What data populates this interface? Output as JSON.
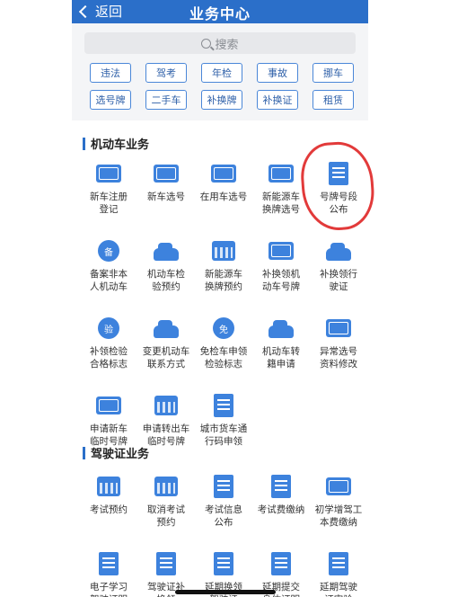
{
  "nav": {
    "back_label": "返回",
    "title": "业务中心"
  },
  "search": {
    "placeholder": "搜索"
  },
  "tags": [
    "违法",
    "驾考",
    "年检",
    "事故",
    "挪车",
    "选号牌",
    "二手车",
    "补换牌",
    "补换证",
    "租赁"
  ],
  "sections": [
    {
      "title": "机动车业务",
      "items": [
        {
          "label": "新车注册\n登记",
          "icon": "new-plate-check-icon"
        },
        {
          "label": "新车选号",
          "icon": "new-plate-icon"
        },
        {
          "label": "在用车选号",
          "icon": "no-plate-icon"
        },
        {
          "label": "新能源车\n换牌选号",
          "icon": "ev-plate-icon"
        },
        {
          "label": "号牌号段\n公布",
          "icon": "plate-announce-icon"
        },
        {
          "label": "备案非本\n人机动车",
          "icon": "record-shield-icon"
        },
        {
          "label": "机动车检\n验预约",
          "icon": "car-inspection-icon"
        },
        {
          "label": "新能源车\n换牌预约",
          "icon": "ev-calendar-icon"
        },
        {
          "label": "补换领机\n动车号牌",
          "icon": "plate-exchange-icon"
        },
        {
          "label": "补换领行\n驶证",
          "icon": "license-exchange-icon"
        },
        {
          "label": "补领检验\n合格标志",
          "icon": "inspect-badge-icon"
        },
        {
          "label": "变更机动车\n联系方式",
          "icon": "car-phone-icon"
        },
        {
          "label": "免检车申领\n检验标志",
          "icon": "exempt-badge-icon"
        },
        {
          "label": "机动车转\n籍申请",
          "icon": "car-transfer-icon"
        },
        {
          "label": "异常选号\n资料修改",
          "icon": "edit-plate-icon"
        },
        {
          "label": "申请新车\n临时号牌",
          "icon": "temp-plate-icon"
        },
        {
          "label": "申请转出车\n临时号牌",
          "icon": "transfer-plate-icon"
        },
        {
          "label": "城市货车通\n行码申领",
          "icon": "truck-pass-icon"
        }
      ]
    },
    {
      "title": "驾驶证业务",
      "items": [
        {
          "label": "考试预约",
          "icon": "exam-calendar-icon"
        },
        {
          "label": "取消考试\n预约",
          "icon": "cancel-calendar-icon"
        },
        {
          "label": "考试信息\n公布",
          "icon": "exam-info-icon"
        },
        {
          "label": "考试费缴纳",
          "icon": "exam-fee-icon"
        },
        {
          "label": "初学增驾工\n本费缴纳",
          "icon": "fee-card-icon"
        },
        {
          "label": "电子学习\n驾驶证明",
          "icon": "e-learning-icon"
        },
        {
          "label": "驾驶证补\n换领",
          "icon": "license-renew-icon"
        },
        {
          "label": "延期换领\n驾驶证",
          "icon": "delay-renew-icon"
        },
        {
          "label": "延期提交\n身体证明",
          "icon": "delay-health-icon"
        },
        {
          "label": "延期驾驶\n证审验",
          "icon": "delay-review-icon"
        }
      ]
    }
  ],
  "colors": {
    "primary": "#2b6fc9",
    "icon": "#3d82dd",
    "annotation": "#e23a3a"
  }
}
